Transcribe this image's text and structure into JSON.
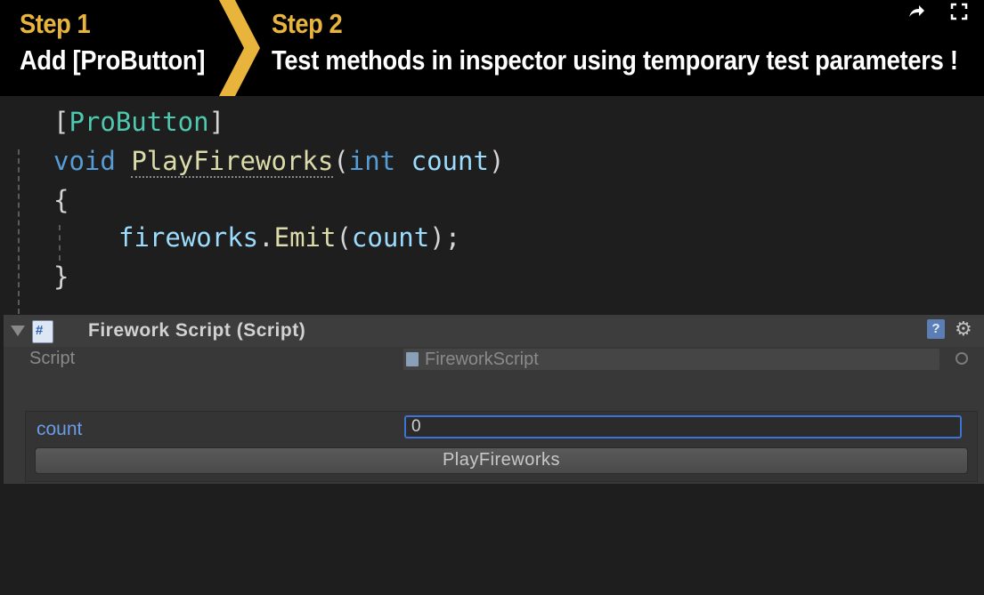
{
  "banner": {
    "step1_label": "Step 1",
    "step1_text": "Add [ProButton]",
    "step2_label": "Step 2",
    "step2_text": "Test methods in inspector using temporary test parameters !",
    "accent_color": "#e8b43c",
    "share_icon": "share-icon",
    "fullscreen_icon": "fullscreen-icon"
  },
  "code": {
    "attr_open": "[",
    "attr_name": "ProButton",
    "attr_close": "]",
    "void_kw": "void",
    "method_name": "PlayFireworks",
    "paren_open": "(",
    "int_kw": "int",
    "param_name": "count",
    "paren_close": ")",
    "brace_open": "{",
    "call_object": "fireworks",
    "call_dot": ".",
    "call_method": "Emit",
    "call_open": "(",
    "call_arg": "count",
    "call_close": ");",
    "brace_close": "}"
  },
  "inspector": {
    "component_title": "Firework Script (Script)",
    "script_label": "Script",
    "script_value": "FireworkScript",
    "param_label": "count",
    "param_value": "0",
    "button_label": "PlayFireworks",
    "help_glyph": "?",
    "gear_glyph": "⚙",
    "script_icon_glyph": "#"
  }
}
